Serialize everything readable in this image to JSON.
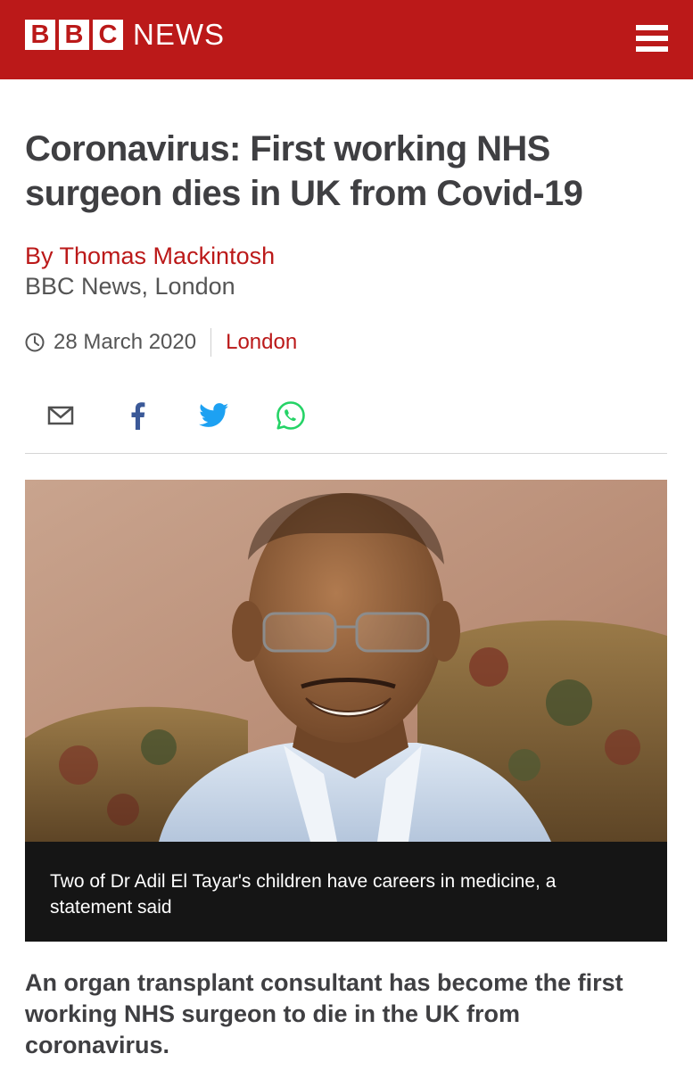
{
  "header": {
    "logo_letters": [
      "B",
      "B",
      "C"
    ],
    "logo_word": "NEWS",
    "brand_color": "#bb1919"
  },
  "article": {
    "headline": "Coronavirus: First working NHS surgeon dies in UK from Covid-19",
    "author": "By Thomas Mackintosh",
    "author_org": "BBC News, London",
    "date": "28 March 2020",
    "location": "London",
    "share_icons": [
      "email-icon",
      "facebook-icon",
      "twitter-icon",
      "whatsapp-icon"
    ],
    "image_caption": "Two of Dr Adil El Tayar's children have careers in medicine, a statement said",
    "intro": "An organ transplant consultant has become the first working NHS surgeon to die in the UK from coronavirus."
  }
}
